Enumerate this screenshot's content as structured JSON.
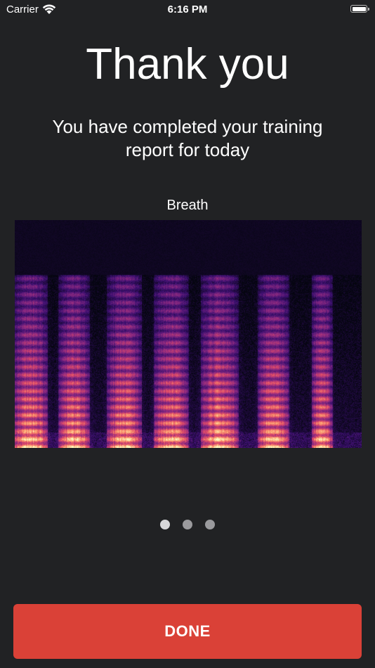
{
  "status_bar": {
    "carrier": "Carrier",
    "time": "6:16 PM"
  },
  "title": "Thank you",
  "subtitle": "You have completed your training report for today",
  "chart_label": "Breath",
  "spectrogram": {
    "colormap": [
      "#050510",
      "#3b0f70",
      "#8c2981",
      "#de4968",
      "#fe9f6d",
      "#fcfdbf"
    ]
  },
  "pager": {
    "count": 3,
    "active_index": 0
  },
  "done_label": "DONE",
  "colors": {
    "background": "#212224",
    "accent": "#da4137"
  }
}
